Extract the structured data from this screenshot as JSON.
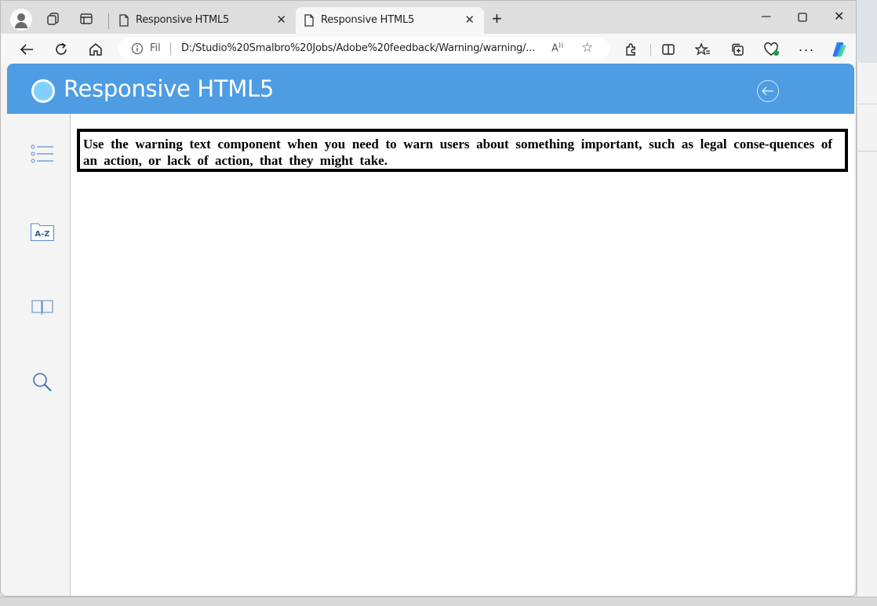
{
  "browser": {
    "tabs": [
      {
        "label": "Responsive HTML5",
        "active": false
      },
      {
        "label": "Responsive HTML5",
        "active": true
      }
    ],
    "address": {
      "scheme_label": "Fil",
      "url": "D:/Studio%20Smalbro%20Jobs/Adobe%20feedback/Warning/warning/..."
    },
    "icons": [
      "profile-icon",
      "workspaces-icon",
      "tab-actions-icon",
      "back-icon",
      "refresh-icon",
      "home-icon",
      "info-icon",
      "read-aloud-icon",
      "favorite-star-icon",
      "extensions-icon",
      "split-screen-icon",
      "favorites-icon",
      "collections-icon",
      "browser-essentials-icon",
      "more-icon",
      "copilot-icon"
    ]
  },
  "app": {
    "title": "Responsive HTML5",
    "accent_color": "#4e9de3",
    "sidebar": [
      {
        "name": "toc-icon"
      },
      {
        "name": "index-icon",
        "label": "A-Z"
      },
      {
        "name": "glossary-icon"
      },
      {
        "name": "search-icon"
      }
    ]
  },
  "content": {
    "warning_text": "Use the warning text component when you need to warn users about something important, such as legal conse-quences of an action, or lack of action, that they might take."
  }
}
